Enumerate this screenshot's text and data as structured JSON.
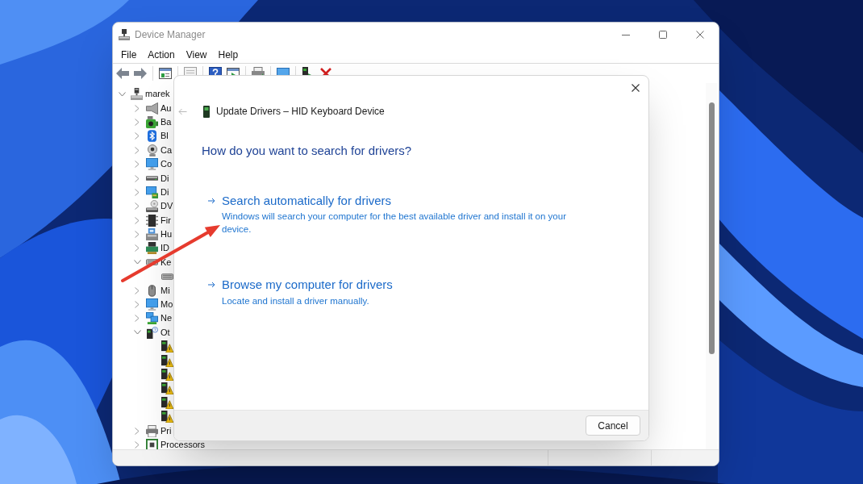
{
  "window": {
    "title": "Device Manager",
    "active": false
  },
  "menu": [
    "File",
    "Action",
    "View",
    "Help"
  ],
  "tree": {
    "label": "marek",
    "kind": "computer",
    "expanded": true,
    "children": [
      {
        "label": "Au",
        "kind": "audio",
        "expanded": false
      },
      {
        "label": "Ba",
        "kind": "battery",
        "expanded": false
      },
      {
        "label": "Bl",
        "kind": "bluetooth",
        "expanded": false
      },
      {
        "label": "Ca",
        "kind": "camera",
        "expanded": false
      },
      {
        "label": "Co",
        "kind": "monitor",
        "expanded": false
      },
      {
        "label": "Di",
        "kind": "drive",
        "expanded": false
      },
      {
        "label": "Di",
        "kind": "display",
        "expanded": false
      },
      {
        "label": "DV",
        "kind": "dvd",
        "expanded": false
      },
      {
        "label": "Fir",
        "kind": "chip",
        "expanded": false
      },
      {
        "label": "Hu",
        "kind": "hid",
        "expanded": false
      },
      {
        "label": "ID",
        "kind": "controller",
        "expanded": false
      },
      {
        "label": "Ke",
        "kind": "keyboard",
        "expanded": true,
        "children": [
          {
            "kind": "keyboard"
          }
        ]
      },
      {
        "label": "Mi",
        "kind": "mouse",
        "expanded": false
      },
      {
        "label": "Mo",
        "kind": "monitor",
        "expanded": false
      },
      {
        "label": "Ne",
        "kind": "network",
        "expanded": false
      },
      {
        "label": "Ot",
        "kind": "unknown",
        "expanded": true,
        "children": [
          {
            "kind": "warning"
          },
          {
            "kind": "warning"
          },
          {
            "kind": "warning"
          },
          {
            "kind": "warning"
          },
          {
            "kind": "warning"
          },
          {
            "kind": "warning"
          }
        ]
      },
      {
        "label": "Pri",
        "kind": "printer",
        "expanded": false
      },
      {
        "label": "Processors",
        "kind": "processor",
        "expanded": false
      }
    ]
  },
  "dialog": {
    "back": {
      "disabled": true
    },
    "title": "Update Drivers – HID Keyboard Device",
    "heading": "How do you want to search for drivers?",
    "options": [
      {
        "title": "Search automatically for drivers",
        "description": "Windows will search your computer for the best available driver and install it on your device."
      },
      {
        "title": "Browse my computer for drivers",
        "description": "Locate and install a driver manually."
      }
    ],
    "buttons": [
      "Cancel"
    ]
  }
}
